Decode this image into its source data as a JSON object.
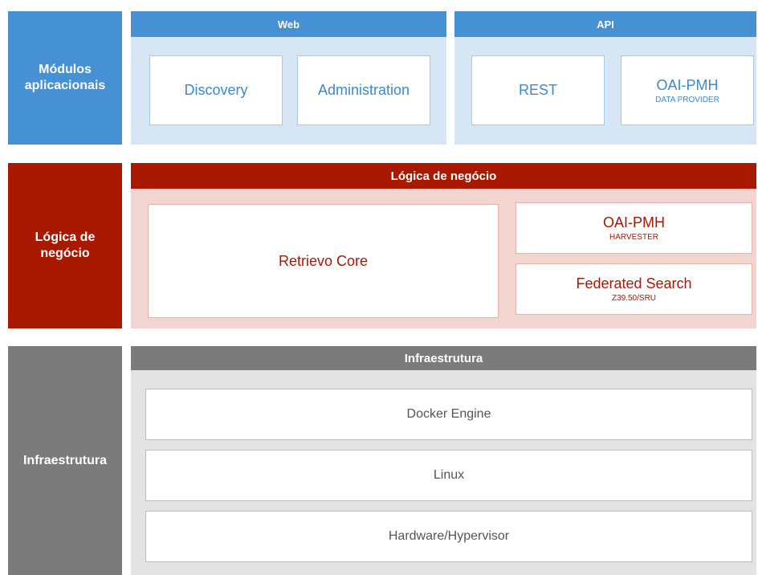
{
  "rows": {
    "apps": {
      "side_label": "Módulos\naplicacionais",
      "web": {
        "header": "Web",
        "boxes": [
          {
            "title": "Discovery"
          },
          {
            "title": "Administration"
          }
        ]
      },
      "api": {
        "header": "API",
        "boxes": [
          {
            "title": "REST"
          },
          {
            "title": "OAI-PMH",
            "subtitle": "DATA PROVIDER"
          }
        ]
      }
    },
    "logic": {
      "side_label": "Lógica de\nnegócio",
      "header": "Lógica de negócio",
      "core": {
        "title": "Retrievo Core"
      },
      "oai_harvester": {
        "title": "OAI-PMH",
        "subtitle": "HARVESTER"
      },
      "federated": {
        "title": "Federated Search",
        "subtitle": "Z39.50/SRU"
      }
    },
    "infra": {
      "side_label": "Infraestrutura",
      "header": "Infraestrutura",
      "layers": [
        {
          "title": "Docker Engine"
        },
        {
          "title": "Linux"
        },
        {
          "title": "Hardware/Hypervisor"
        }
      ]
    }
  },
  "colors": {
    "blue": "#4591d3",
    "blue_panel": "#d6e6f5",
    "red": "#a81900",
    "red_panel": "#f2d4d1",
    "gray": "#7b7b7b",
    "gray_panel": "#e3e3e3"
  }
}
